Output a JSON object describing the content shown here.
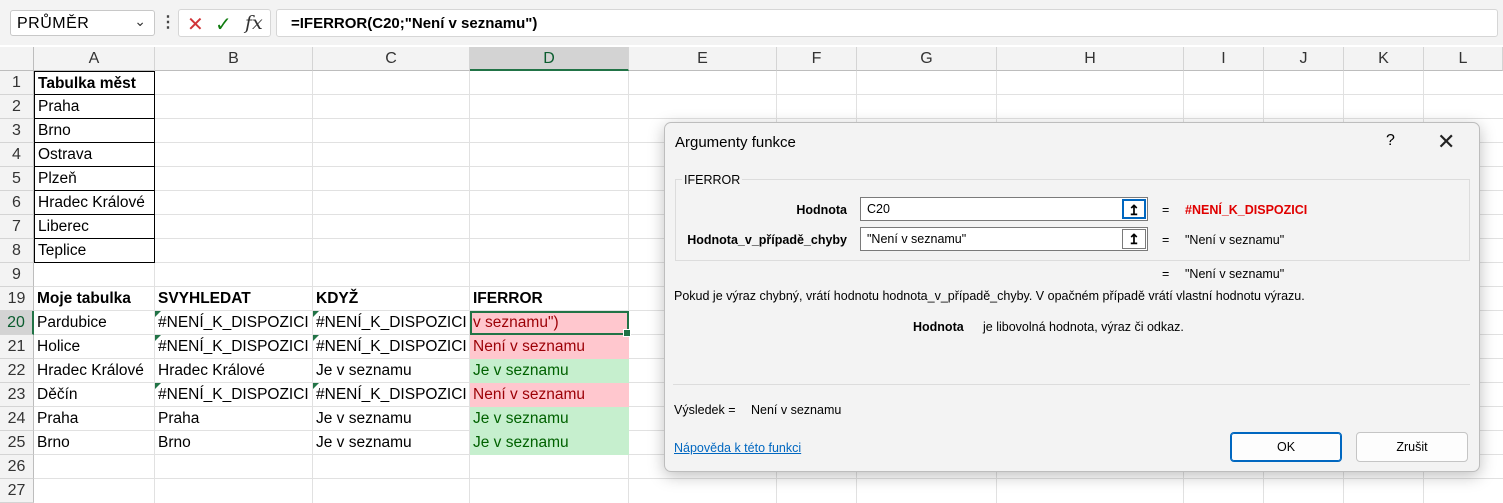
{
  "formula_bar": {
    "name_box": "PRŮMĚR",
    "cancel_icon": "✕",
    "enter_icon": "✓",
    "fx_label": "fx",
    "formula": "=IFERROR(C20;\"Není v seznamu\")"
  },
  "columns": [
    "A",
    "B",
    "C",
    "D",
    "E",
    "F",
    "G",
    "H",
    "I",
    "J",
    "K",
    "L"
  ],
  "rows": [
    "1",
    "2",
    "3",
    "4",
    "5",
    "6",
    "7",
    "8",
    "9",
    "19",
    "20",
    "21",
    "22",
    "23",
    "24",
    "25",
    "26",
    "27"
  ],
  "cities_table": {
    "header": "Tabulka měst",
    "items": [
      "Praha",
      "Brno",
      "Ostrava",
      "Plzeň",
      "Hradec Králové",
      "Liberec",
      "Teplice"
    ]
  },
  "my_table": {
    "headers": [
      "Moje tabulka",
      "SVYHLEDAT",
      "KDYŽ",
      "IFERROR"
    ],
    "rows": [
      [
        "Pardubice",
        "#NENÍ_K_DISPOZICI",
        "#NENÍ_K_DISPOZICI",
        "v seznamu\")"
      ],
      [
        "Holice",
        "#NENÍ_K_DISPOZICI",
        "#NENÍ_K_DISPOZICI",
        "Není v seznamu"
      ],
      [
        "Hradec Králové",
        "Hradec Králové",
        "Je v seznamu",
        "Je v seznamu"
      ],
      [
        "Děčín",
        "#NENÍ_K_DISPOZICI",
        "#NENÍ_K_DISPOZICI",
        "Není v seznamu"
      ],
      [
        "Praha",
        "Praha",
        "Je v seznamu",
        "Je v seznamu"
      ],
      [
        "Brno",
        "Brno",
        "Je v seznamu",
        "Je v seznamu"
      ]
    ]
  },
  "dialog": {
    "title": "Argumenty funkce",
    "help_glyph": "?",
    "close_glyph": "✕",
    "function_name": "IFERROR",
    "args": [
      {
        "label": "Hodnota",
        "value": "C20",
        "result": "#NENÍ_K_DISPOZICI"
      },
      {
        "label": "Hodnota_v_případě_chyby",
        "value": "\"Není v seznamu\"",
        "result": "\"Není v seznamu\""
      }
    ],
    "equals": "=",
    "formula_result": "\"Není v seznamu\"",
    "description": "Pokud je výraz chybný, vrátí hodnotu hodnota_v_případě_chyby. V opačném případě vrátí vlastní hodnotu výrazu.",
    "param_name": "Hodnota",
    "param_description": "je libovolná hodnota, výraz či odkaz.",
    "result_label": "Výsledek =",
    "result_value": "Není v seznamu",
    "help_link": "Nápověda k této funkci",
    "ok_label": "OK",
    "cancel_label": "Zrušit"
  },
  "colors": {
    "red_fill": "#ffc7ce",
    "red_text": "#9c0006",
    "green_fill": "#c6efce",
    "green_text": "#006100",
    "accent": "#217346"
  }
}
